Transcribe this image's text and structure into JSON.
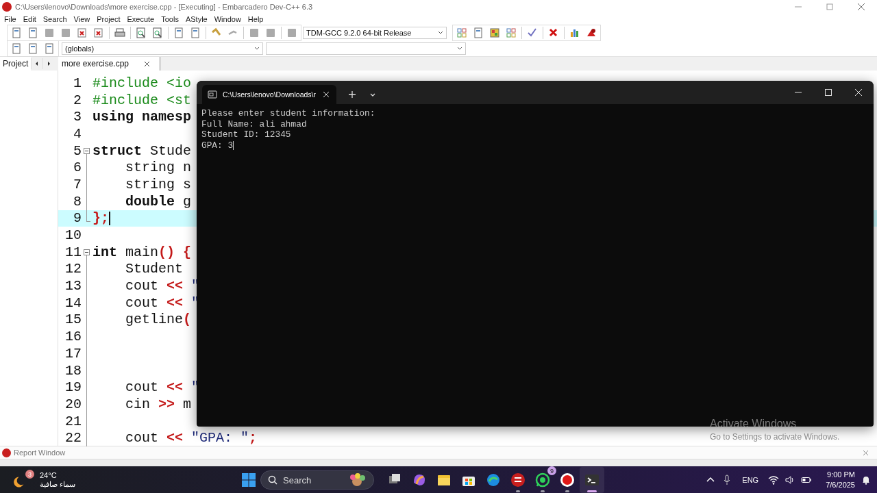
{
  "window": {
    "title": "C:\\Users\\lenovo\\Downloads\\more exercise.cpp - [Executing] - Embarcadero Dev-C++ 6.3"
  },
  "menu": [
    "File",
    "Edit",
    "Search",
    "View",
    "Project",
    "Execute",
    "Tools",
    "AStyle",
    "Window",
    "Help"
  ],
  "toolbar": {
    "compiler": "TDM-GCC 9.2.0 64-bit Release",
    "scope": "(globals)"
  },
  "side_panel": {
    "tab": "Project"
  },
  "editor_tabs": [
    {
      "label": "more exercise.cpp",
      "selected": true
    }
  ],
  "editor": {
    "lines": [
      {
        "number": "1",
        "kind": "plain",
        "current": false,
        "tokens": [
          {
            "text": "#include <io",
            "kind": "pre"
          }
        ]
      },
      {
        "number": "2",
        "kind": "plain",
        "current": false,
        "tokens": [
          {
            "text": "#include <st",
            "kind": "pre"
          }
        ]
      },
      {
        "number": "3",
        "kind": "plain",
        "current": false,
        "tokens": [
          {
            "text": "using namesp",
            "kind": "kw"
          }
        ]
      },
      {
        "number": "4",
        "kind": "plain",
        "current": false
      },
      {
        "number": "5",
        "kind": "fold_start",
        "current": false,
        "tokens": [
          {
            "text": "struct",
            "kind": "kw"
          },
          {
            "text": " Stude",
            "kind": "plain"
          }
        ]
      },
      {
        "number": "6",
        "kind": "fold_body",
        "current": false,
        "tokens": [
          {
            "text": "    string n",
            "kind": "plain"
          }
        ]
      },
      {
        "number": "7",
        "kind": "fold_body",
        "current": false,
        "tokens": [
          {
            "text": "    string s",
            "kind": "plain"
          }
        ]
      },
      {
        "number": "8",
        "kind": "fold_body",
        "current": false,
        "tokens": [
          {
            "text": "    double",
            "kind": "kw"
          },
          {
            "text": " g",
            "kind": "plain"
          }
        ]
      },
      {
        "number": "9",
        "kind": "fold_end",
        "current": true,
        "tokens": [
          {
            "text": "};",
            "kind": "sym"
          }
        ]
      },
      {
        "number": "10",
        "kind": "plain",
        "current": false
      },
      {
        "number": "11",
        "kind": "fold_start",
        "current": false,
        "tokens": [
          {
            "text": "int",
            "kind": "kw"
          },
          {
            "text": " main",
            "kind": "plain"
          },
          {
            "text": "() {",
            "kind": "sym"
          }
        ]
      },
      {
        "number": "12",
        "kind": "fold_body",
        "current": false,
        "tokens": [
          {
            "text": "    Student",
            "kind": "plain"
          }
        ]
      },
      {
        "number": "13",
        "kind": "fold_body",
        "current": false,
        "tokens": [
          {
            "text": "    cout ",
            "kind": "plain"
          },
          {
            "text": "<<",
            "kind": "sym"
          },
          {
            "text": " \"",
            "kind": "str"
          }
        ]
      },
      {
        "number": "14",
        "kind": "fold_body",
        "current": false,
        "tokens": [
          {
            "text": "    cout ",
            "kind": "plain"
          },
          {
            "text": "<<",
            "kind": "sym"
          },
          {
            "text": " \"",
            "kind": "str"
          }
        ]
      },
      {
        "number": "15",
        "kind": "fold_body",
        "current": false,
        "tokens": [
          {
            "text": "    getline",
            "kind": "plain"
          },
          {
            "text": "(",
            "kind": "sym"
          }
        ]
      },
      {
        "number": "16",
        "kind": "fold_body",
        "current": false
      },
      {
        "number": "17",
        "kind": "fold_body",
        "current": false
      },
      {
        "number": "18",
        "kind": "fold_body",
        "current": false
      },
      {
        "number": "19",
        "kind": "fold_body",
        "current": false,
        "tokens": [
          {
            "text": "    cout ",
            "kind": "plain"
          },
          {
            "text": "<<",
            "kind": "sym"
          },
          {
            "text": " \"",
            "kind": "str"
          }
        ]
      },
      {
        "number": "20",
        "kind": "fold_body",
        "current": false,
        "tokens": [
          {
            "text": "    cin ",
            "kind": "plain"
          },
          {
            "text": ">>",
            "kind": "sym"
          },
          {
            "text": " m",
            "kind": "plain"
          }
        ]
      },
      {
        "number": "21",
        "kind": "fold_body",
        "current": false
      },
      {
        "number": "22",
        "kind": "fold_body",
        "current": false,
        "tokens": [
          {
            "text": "    cout ",
            "kind": "plain"
          },
          {
            "text": "<<",
            "kind": "sym"
          },
          {
            "text": " \"GPA: \"",
            "kind": "str"
          },
          {
            "text": ";",
            "kind": "sym"
          }
        ]
      }
    ]
  },
  "console": {
    "tab_title": "C:\\Users\\lenovo\\Downloads\\r",
    "output": [
      "Please enter student information:",
      "Full Name: ali ahmad",
      "Student ID: 12345",
      "GPA: 3"
    ]
  },
  "report_window": {
    "title": "Report Window"
  },
  "activation_notice": {
    "title": "Activate Windows",
    "hint": "Go to Settings to activate Windows."
  },
  "taskbar": {
    "weather": {
      "badge": "3",
      "temperature": "24°C",
      "condition": "سماء صافية"
    },
    "search": {
      "label": "Search"
    },
    "apps": [
      {
        "kind": "taskview",
        "active": false,
        "running": false
      },
      {
        "kind": "copilot",
        "active": false,
        "running": false
      },
      {
        "kind": "explorer",
        "active": false,
        "running": false
      },
      {
        "kind": "store",
        "active": false,
        "running": false
      },
      {
        "kind": "edge",
        "active": false,
        "running": false
      },
      {
        "kind": "devcpp",
        "active": false,
        "running": true
      },
      {
        "kind": "whatsapp",
        "active": false,
        "running": true,
        "badge": "9"
      },
      {
        "kind": "recorder",
        "active": false,
        "running": true
      },
      {
        "kind": "terminal",
        "active": true,
        "running": true
      }
    ],
    "tray": {
      "language": "ENG",
      "time": "9:00 PM",
      "date": "7/6/2025"
    }
  }
}
